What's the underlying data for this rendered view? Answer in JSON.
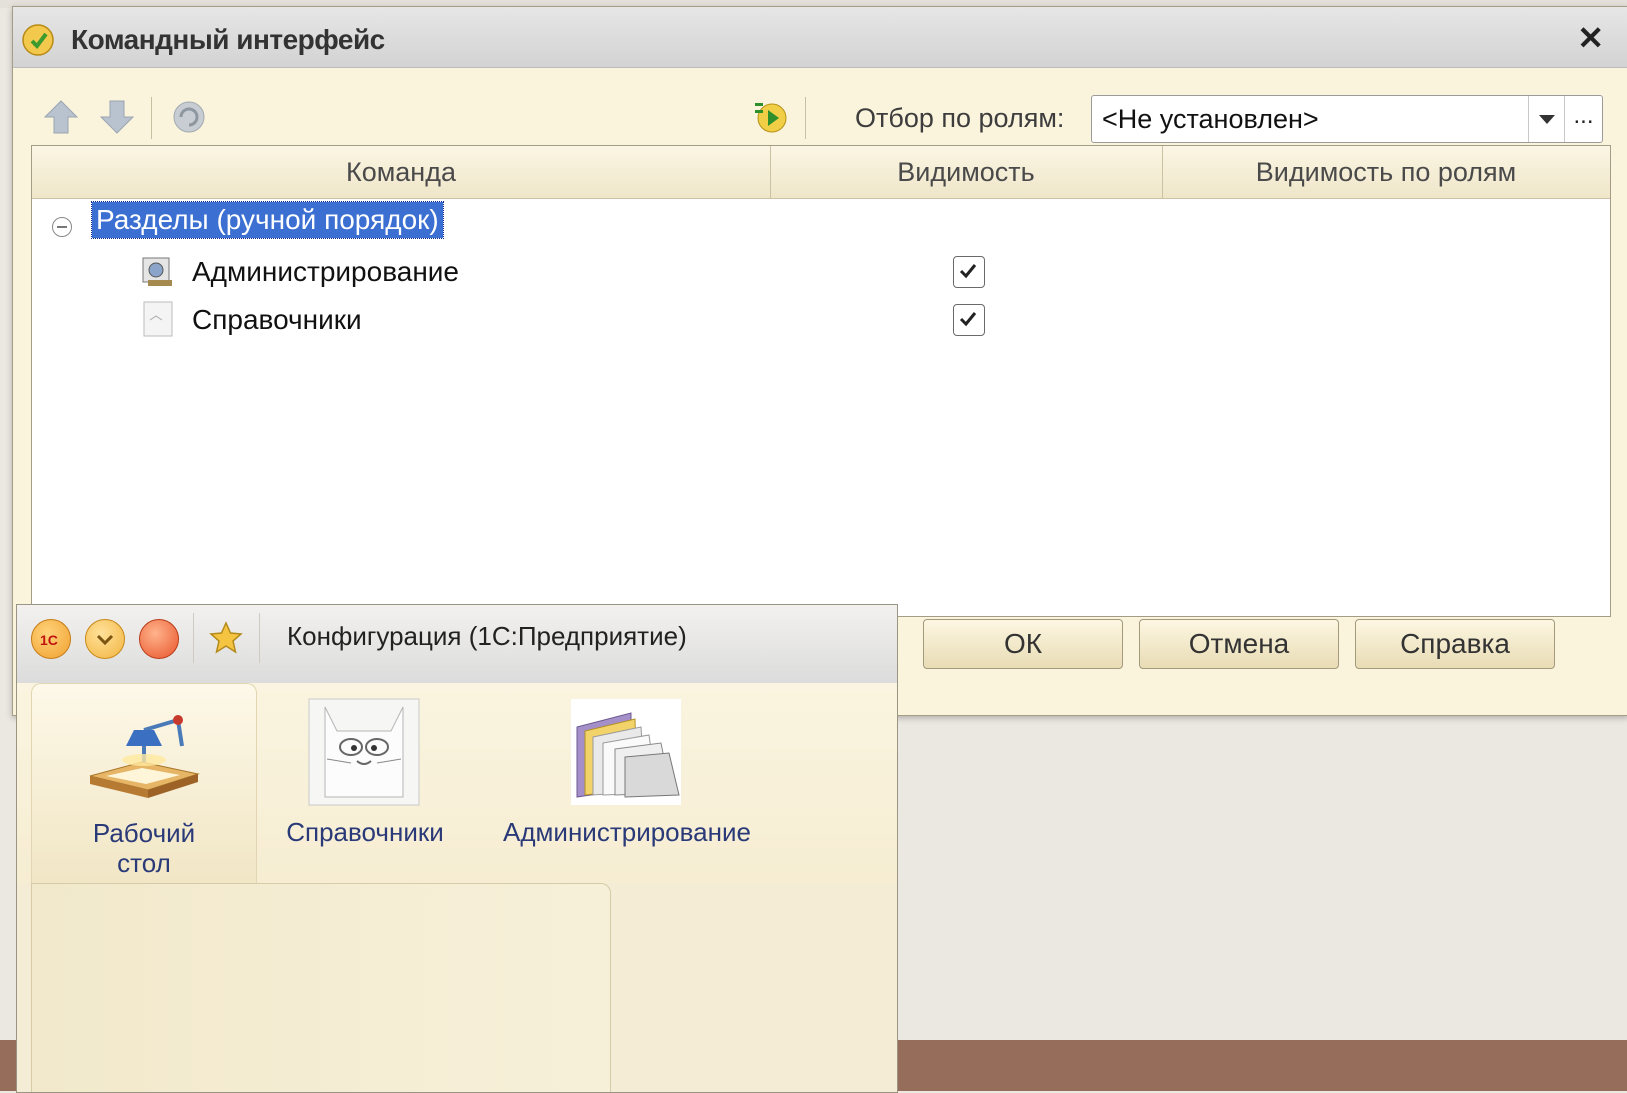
{
  "dialog": {
    "title": "Командный интерфейс",
    "close_glyph": "✕",
    "filter_label": "Отбор по ролям:",
    "filter_value": "<Не установлен>",
    "filter_more": "...",
    "columns": [
      "Команда",
      "Видимость",
      "Видимость по ролям"
    ],
    "group": "Разделы (ручной порядок)",
    "rows": [
      {
        "label": "Администрирование",
        "visible": true,
        "icon": "administration-icon"
      },
      {
        "label": "Справочники",
        "visible": true,
        "icon": "catalogs-icon"
      }
    ],
    "buttons": {
      "ok": "ОК",
      "cancel": "Отмена",
      "help": "Справка"
    }
  },
  "app": {
    "title": "Конфигурация  (1С:Предприятие)",
    "sections": [
      {
        "label": "Рабочий\nстол",
        "icon": "desktop-lamp-icon",
        "active": true
      },
      {
        "label": "Справочники",
        "icon": "cat-icon",
        "active": false
      },
      {
        "label": "Администрирование",
        "icon": "folders-icon",
        "active": false
      }
    ]
  },
  "colors": {
    "selection": "#3b6fd1",
    "dialog_bg": "#fbf4dd",
    "slide_band": "#956d5a"
  }
}
